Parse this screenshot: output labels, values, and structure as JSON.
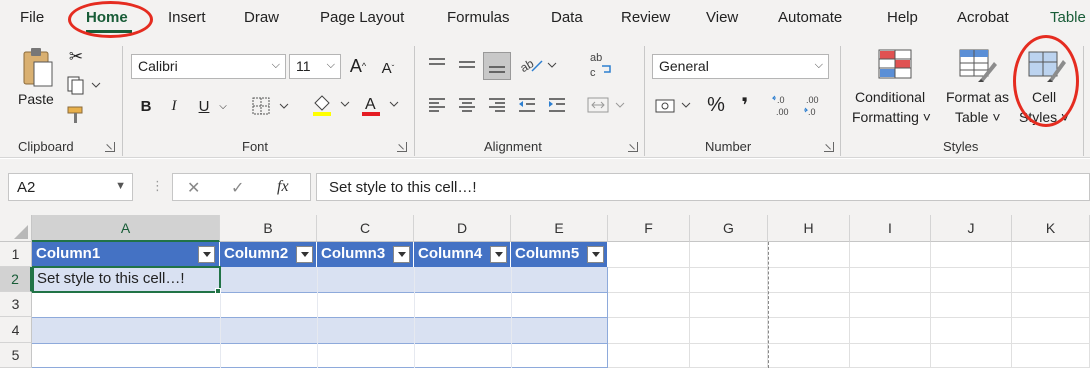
{
  "tabs": {
    "file": "File",
    "home": "Home",
    "insert": "Insert",
    "draw": "Draw",
    "page_layout": "Page Layout",
    "formulas": "Formulas",
    "data": "Data",
    "review": "Review",
    "view": "View",
    "automate": "Automate",
    "help": "Help",
    "acrobat": "Acrobat",
    "table": "Table"
  },
  "ribbon": {
    "clipboard": {
      "label": "Clipboard",
      "paste": "Paste"
    },
    "font": {
      "label": "Font",
      "name": "Calibri",
      "size": "11",
      "bold": "B",
      "italic": "I",
      "underline": "U"
    },
    "alignment": {
      "label": "Alignment"
    },
    "number": {
      "label": "Number",
      "format": "General",
      "percent": "%",
      "comma": "❜"
    },
    "styles": {
      "label": "Styles",
      "conditional_line1": "Conditional",
      "conditional_line2": "Formatting ˅",
      "format_table_line1": "Format as",
      "format_table_line2": "Table ˅",
      "cell_styles_line1": "Cell",
      "cell_styles_line2": "Styles ˅"
    }
  },
  "formula_bar": {
    "name_box": "A2",
    "cancel": "✕",
    "enter": "✓",
    "fx": "fx",
    "content": "Set style to this cell…!"
  },
  "grid": {
    "columns": [
      "A",
      "B",
      "C",
      "D",
      "E",
      "F",
      "G",
      "H",
      "I",
      "J",
      "K"
    ],
    "rows": [
      "1",
      "2",
      "3",
      "4",
      "5"
    ],
    "table_headers": [
      "Column1",
      "Column2",
      "Column3",
      "Column4",
      "Column5"
    ],
    "active_cell_text": "Set style to this cell…!"
  },
  "colors": {
    "table_header": "#4472c4",
    "band": "#d9e1f2",
    "accent_green": "#217346",
    "annotation_red": "#e52c20"
  }
}
